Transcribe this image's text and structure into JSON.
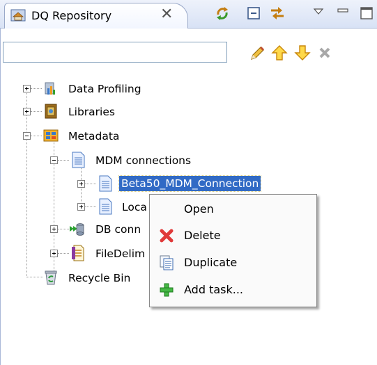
{
  "view_tab": {
    "title": "DQ Repository",
    "close_symbol": "✕"
  },
  "toolbar": {
    "sync_icon": "sync-icon",
    "collapse_icon": "collapse-all-icon",
    "link_icon": "link-editor-icon",
    "menu_icon": "view-menu-icon",
    "minimize_icon": "minimize-icon",
    "maximize_icon": "maximize-icon"
  },
  "filter": {
    "value": "",
    "placeholder": ""
  },
  "tree": {
    "data_profiling": "Data Profiling",
    "libraries": "Libraries",
    "metadata": "Metadata",
    "mdm_connections": "MDM connections",
    "beta50": "Beta50_MDM_Connection",
    "loca": "Loca",
    "db_conn": "DB conn",
    "file_delim": "FileDelim",
    "recycle_bin": "Recycle Bin"
  },
  "context_menu": {
    "open": "Open",
    "delete": "Delete",
    "duplicate": "Duplicate",
    "add_task": "Add task..."
  },
  "colors": {
    "selection": "#316ac5",
    "tab_gradient_top": "#eef2fb",
    "tab_gradient_bottom": "#d8e2f5"
  }
}
